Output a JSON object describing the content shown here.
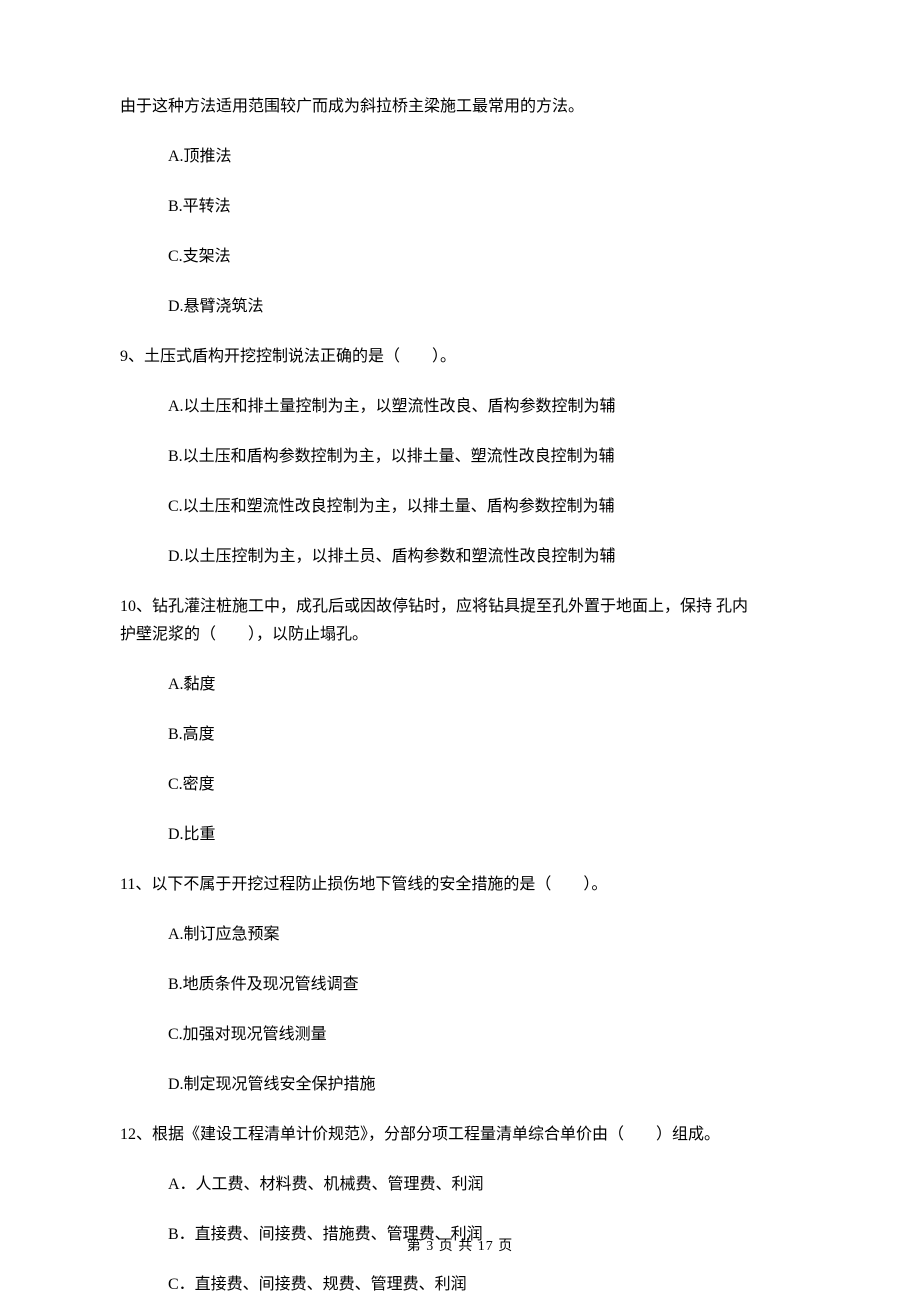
{
  "intro_tail": "由于这种方法适用范围较广而成为斜拉桥主梁施工最常用的方法。",
  "intro_options": {
    "a": "A.顶推法",
    "b": "B.平转法",
    "c": "C.支架法",
    "d": "D.悬臂浇筑法"
  },
  "q9": {
    "stem": "9、土压式盾构开挖控制说法正确的是（　　）。",
    "a": "A.以土压和排土量控制为主，以塑流性改良、盾构参数控制为辅",
    "b": "B.以土压和盾构参数控制为主，以排土量、塑流性改良控制为辅",
    "c": "C.以土压和塑流性改良控制为主，以排土量、盾构参数控制为辅",
    "d": "D.以土压控制为主，以排土员、盾构参数和塑流性改良控制为辅"
  },
  "q10": {
    "stem_line1": "10、钻孔灌注桩施工中，成孔后或因故停钻时，应将钻具提至孔外置于地面上，保持 孔内",
    "stem_line2": "护壁泥浆的（　　），以防止塌孔。",
    "a": "A.黏度",
    "b": "B.高度",
    "c": "C.密度",
    "d": "D.比重"
  },
  "q11": {
    "stem": "11、以下不属于开挖过程防止损伤地下管线的安全措施的是（　　）。",
    "a": "A.制订应急预案",
    "b": "B.地质条件及现况管线调查",
    "c": "C.加强对现况管线测量",
    "d": "D.制定现况管线安全保护措施"
  },
  "q12": {
    "stem": "12、根据《建设工程清单计价规范》，分部分项工程量清单综合单价由（　　）组成。",
    "a": "A．人工费、材料费、机械费、管理费、利润",
    "b": "B．直接费、间接费、措施费、管理费、利润",
    "c": "C．直接费、间接费、规费、管理费、利润"
  },
  "footer": "第 3 页 共 17 页"
}
